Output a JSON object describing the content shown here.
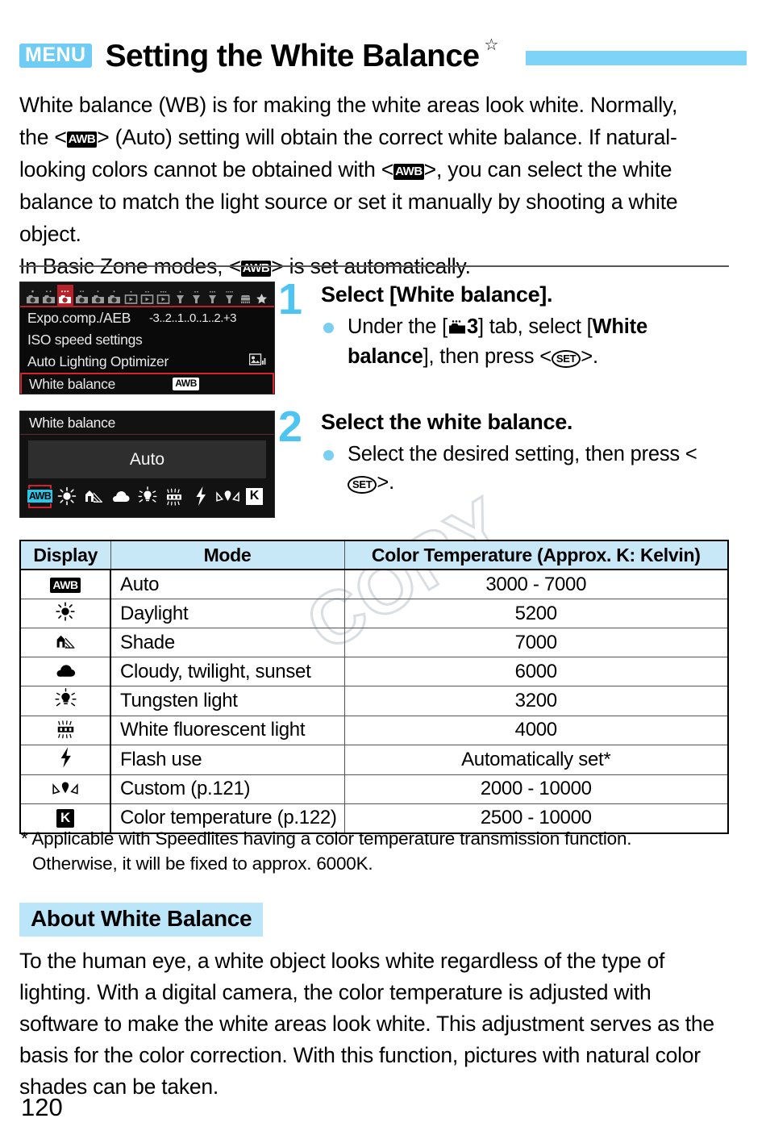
{
  "header": {
    "menu_badge": "MENU",
    "title": "Setting the White Balance",
    "star": "☆"
  },
  "intro": {
    "line1_a": "White balance (WB) is for making the white areas look white. Normally,",
    "line2_a": "the <",
    "awb": "AWB",
    "line2_b": "> (Auto) setting will obtain the correct white balance. If natural-",
    "line3_a": "looking colors cannot be obtained with <",
    "line3_b": ">, you can select the white",
    "line4": "balance to match the light source or set it manually by shooting a white",
    "line5": "object.",
    "line6_a": "In Basic Zone modes, <",
    "line6_b": "> is set automatically."
  },
  "lcd1": {
    "rows": [
      {
        "label": "Expo.comp./AEB",
        "value": "-3..2..1..0..1..2.+3",
        "selected": false
      },
      {
        "label": "ISO speed settings",
        "value": "",
        "selected": false
      },
      {
        "label": "Auto Lighting Optimizer",
        "value": "",
        "selected": false
      },
      {
        "label": "White balance",
        "value": "AWB",
        "selected": true
      }
    ]
  },
  "lcd2": {
    "title": "White balance",
    "current": "Auto",
    "icons": [
      "awb-icon",
      "daylight-icon",
      "shade-icon",
      "cloudy-icon",
      "tungsten-icon",
      "fluorescent-icon",
      "flash-icon",
      "custom-icon",
      "kelvin-icon"
    ],
    "kelvin_label": "K",
    "awb_label": "AWB"
  },
  "steps": [
    {
      "number": "1",
      "heading": "Select [White balance].",
      "bullet_a": "Under the [",
      "bullet_tab": "3",
      "bullet_b": "] tab, select [",
      "bullet_bold": "White balance",
      "bullet_c": "], then press <",
      "set": "SET",
      "bullet_d": ">."
    },
    {
      "number": "2",
      "heading": "Select the white balance.",
      "bullet_a": "Select the desired setting, then press <",
      "set": "SET",
      "bullet_d": ">."
    }
  ],
  "table": {
    "headers": [
      "Display",
      "Mode",
      "Color Temperature (Approx. K: Kelvin)"
    ],
    "rows": [
      {
        "icon": "awb-icon",
        "display_text": "AWB",
        "mode": "Auto",
        "temp": "3000 - 7000"
      },
      {
        "icon": "daylight-icon",
        "display_text": "",
        "mode": "Daylight",
        "temp": "5200"
      },
      {
        "icon": "shade-icon",
        "display_text": "",
        "mode": "Shade",
        "temp": "7000"
      },
      {
        "icon": "cloudy-icon",
        "display_text": "",
        "mode": "Cloudy, twilight, sunset",
        "temp": "6000"
      },
      {
        "icon": "tungsten-icon",
        "display_text": "",
        "mode": "Tungsten light",
        "temp": "3200"
      },
      {
        "icon": "fluorescent-icon",
        "display_text": "",
        "mode": "White fluorescent light",
        "temp": "4000"
      },
      {
        "icon": "flash-icon",
        "display_text": "",
        "mode": "Flash use",
        "temp": "Automatically set*"
      },
      {
        "icon": "custom-icon",
        "display_text": "",
        "mode": "Custom (p.121)",
        "temp": "2000 - 10000"
      },
      {
        "icon": "kelvin-icon",
        "display_text": "K",
        "mode": "Color temperature (p.122)",
        "temp": "2500 - 10000"
      }
    ]
  },
  "watermark": "COPY",
  "footnote": {
    "line1": "* Applicable with Speedlites having a color temperature transmission function.",
    "line2": "Otherwise, it will be fixed to approx. 6000K."
  },
  "section": {
    "heading": "About White Balance",
    "body": "To the human eye, a white object looks white regardless of the type of lighting. With a digital camera, the color temperature is adjusted with software to make the white areas look white. This adjustment serves as the basis for the color correction. With this function, pictures with natural color shades can be taken."
  },
  "page_number": "120",
  "colors": {
    "accent_blue": "#7ED3F8",
    "badge_blue": "#6ECCF5",
    "heading_highlight": "#BBE5F8",
    "table_header": "#C8E8F8",
    "step_number": "#4DC4F2",
    "bullet": "#7ACFF0",
    "lcd_red": "#d9222c",
    "awb_cyan": "#28c8e8"
  }
}
